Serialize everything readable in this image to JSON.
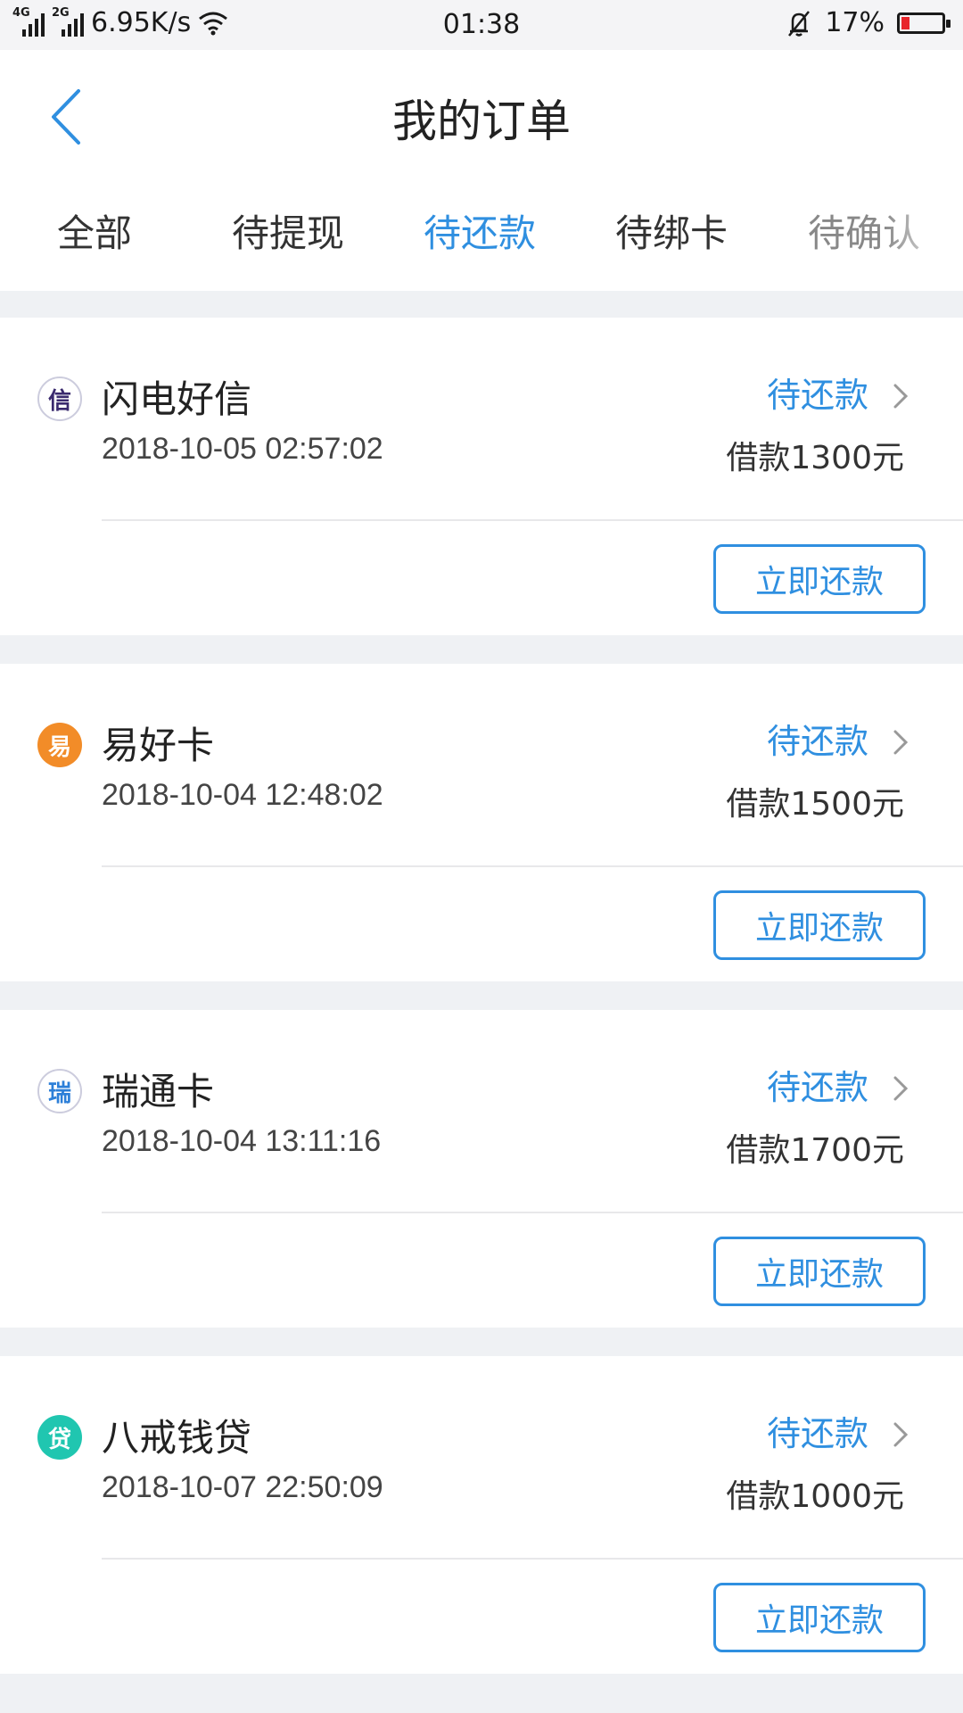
{
  "status_bar": {
    "sim1_tag": "4G",
    "sim2_tag": "2G",
    "net_speed": "6.95K/s",
    "time": "01:38",
    "battery": "17%",
    "battery_color": "#e8252b"
  },
  "header": {
    "title": "我的订单"
  },
  "tabs": [
    {
      "label": "全部"
    },
    {
      "label": "待提现"
    },
    {
      "label": "待还款"
    },
    {
      "label": "待绑卡"
    },
    {
      "label": "待确认"
    }
  ],
  "active_tab": "待还款",
  "accent_color": "#2f8fe0",
  "orders": [
    {
      "logo_char": "信",
      "name": "闪电好信",
      "date": "2018-10-05 02:57:02",
      "status": "待还款",
      "amount": "借款1300元",
      "action": "立即还款"
    },
    {
      "logo_char": "易",
      "name": "易好卡",
      "date": "2018-10-04 12:48:02",
      "status": "待还款",
      "amount": "借款1500元",
      "action": "立即还款"
    },
    {
      "logo_char": "瑞",
      "name": "瑞通卡",
      "date": "2018-10-04 13:11:16",
      "status": "待还款",
      "amount": "借款1700元",
      "action": "立即还款"
    },
    {
      "logo_char": "贷",
      "name": "八戒钱贷",
      "date": "2018-10-07 22:50:09",
      "status": "待还款",
      "amount": "借款1000元",
      "action": "立即还款"
    }
  ]
}
